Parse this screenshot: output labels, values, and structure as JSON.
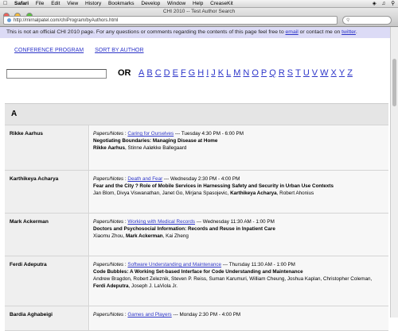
{
  "menubar": {
    "app": "Safari",
    "items": [
      "File",
      "Edit",
      "View",
      "History",
      "Bookmarks",
      "Develop",
      "Window",
      "Help",
      "CreaseKit"
    ]
  },
  "window": {
    "title": "CHI 2010 -- Test Author Search",
    "url": "http://mirnalpatel.com/chiProgram/byAuthors.html"
  },
  "notice": {
    "text_before": "This is not an official CHI 2010 page. For any questions or comments regarding the contents of this page feel free to ",
    "email_link": "email",
    "text_middle": " or contact me on ",
    "twitter_link": "twitter",
    "text_after": "."
  },
  "nav": {
    "conference_program": "CONFERENCE PROGRAM",
    "sort_by_author": "SORT BY AUTHOR"
  },
  "search": {
    "or_label": "OR",
    "letters": [
      "A",
      "B",
      "C",
      "D",
      "E",
      "F",
      "G",
      "H",
      "I",
      "J",
      "K",
      "L",
      "M",
      "N",
      "O",
      "P",
      "Q",
      "R",
      "S",
      "T",
      "U",
      "V",
      "W",
      "X",
      "Y",
      "Z"
    ]
  },
  "section_letter": "A",
  "authors": [
    {
      "name": "Rikke Aarhus",
      "type": "Papers/Notes",
      "session": "Caring for Ourselves",
      "time": "--- Tuesday 4:30 PM - 6:00 PM",
      "title": "Negotiating Boundaries: Managing Disease at Home",
      "authors_before": "",
      "authors_bold": "Rikke Aarhus",
      "authors_after": ", Stinne Aaløkke Ballegaard"
    },
    {
      "name": "Karthikeya Acharya",
      "type": "Papers/Notes",
      "session": "Death and Fear",
      "time": "--- Wednesday 2:30 PM - 4:00 PM",
      "title": "Fear and the City ? Role of Mobile Services in Harnessing Safety and Security in Urban Use Contexts",
      "authors_before": "Jan Blom, Divya Viswanathan, Janet Go, Mirjana Spasojevic, ",
      "authors_bold": "Karthikeya Acharya",
      "authors_after": ", Robert Ahonius"
    },
    {
      "name": "Mark Ackerman",
      "type": "Papers/Notes",
      "session": "Working with Medical Records",
      "time": "--- Wednesday 11:30 AM - 1:00 PM",
      "title": "Doctors and Psychosocial Information: Records and Reuse in Inpatient Care",
      "authors_before": "Xiaomu Zhou, ",
      "authors_bold": "Mark Ackerman",
      "authors_after": ", Kai Zheng"
    },
    {
      "name": "Ferdi Adeputra",
      "type": "Papers/Notes",
      "session": "Software Understanding and Maintenance",
      "time": "--- Thursday 11:30 AM - 1:00 PM",
      "title": "Code Bubbles: A Working Set-based Interface for Code Understanding and Maintenance",
      "authors_before": "Andrew Bragdon, Robert Zeleznik, Steven P. Reiss, Suman Karumuri, William Cheung, Joshua Kaplan, Christopher Coleman, ",
      "authors_bold": "Ferdi Adeputra",
      "authors_after": ", Joseph J. LaViola Jr."
    },
    {
      "name": "Bardia Aghabeigi",
      "type": "Papers/Notes",
      "session": "Games and Players",
      "time": "--- Monday 2:30 PM - 4:00 PM",
      "title": "",
      "authors_before": "",
      "authors_bold": "",
      "authors_after": ""
    }
  ]
}
